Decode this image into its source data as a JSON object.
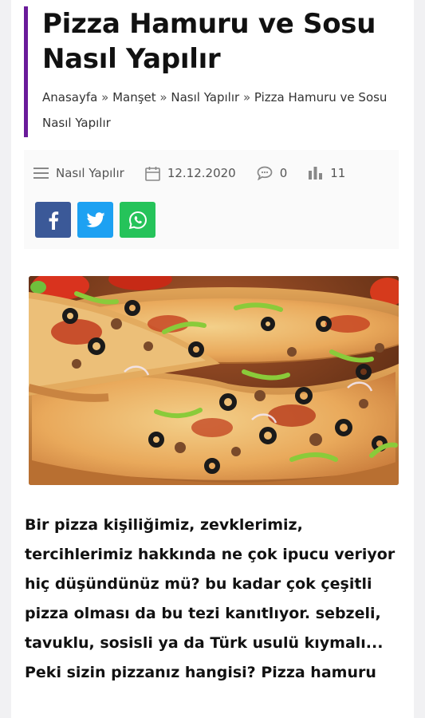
{
  "post": {
    "title": "Pizza Hamuru ve Sosu Nasıl Yapılır",
    "breadcrumb": {
      "items": [
        "Anasayfa",
        "Manşet",
        "Nasıl Yapılır",
        "Pizza Hamuru ve Sosu Nasıl Yapılır"
      ],
      "separator": "»"
    },
    "meta": {
      "category": "Nasıl Yapılır",
      "date": "12.12.2020",
      "comments": "0",
      "views": "11"
    },
    "share": {
      "facebook_icon": "facebook-icon",
      "twitter_icon": "twitter-icon",
      "whatsapp_icon": "whatsapp-icon"
    },
    "body": "Bir pizza kişiliğimiz, zevklerimiz, tercihlerimiz hakkında ne çok ipucu veriyor hiç düşündünüz mü? bu kadar çok çeşitli pizza olması da bu tezi kanıtlıyor. sebzeli, tavuklu, sosisli ya da Türk usulü kıymalı... Peki sizin pizzanız hangisi? Pizza hamuru"
  },
  "colors": {
    "accent_bar": "#6a1b9a",
    "facebook": "#3b5998",
    "twitter": "#1da1f2",
    "whatsapp": "#25c35a"
  }
}
